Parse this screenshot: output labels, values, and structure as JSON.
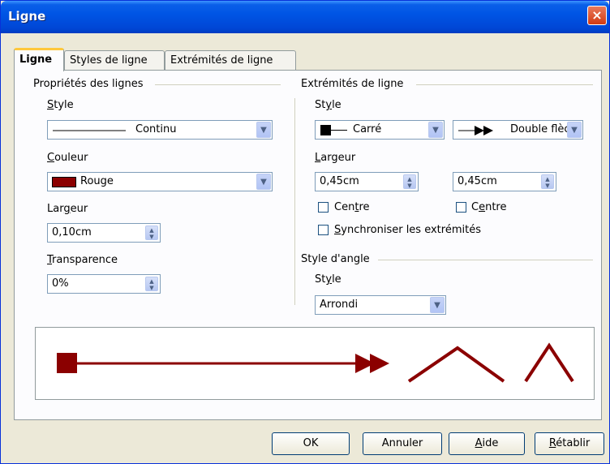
{
  "window": {
    "title": "Ligne",
    "close": "×"
  },
  "tabs": [
    "Ligne",
    "Styles de ligne",
    "Extrémités de ligne"
  ],
  "line_props": {
    "group_title": "Propriétés des lignes",
    "style_label": "Style",
    "style_value": "Continu",
    "color_label": "Couleur",
    "color_value": "Rouge",
    "color_swatch": "#8b0000",
    "width_label": "Largeur",
    "width_value": "0,10cm",
    "transparency_label": "Transparence",
    "transparency_value": "0%"
  },
  "endpoints": {
    "group_title": "Extrémités de ligne",
    "style_label": "Style",
    "start_style": "Carré",
    "end_style": "Double flèc",
    "width_label": "Largeur",
    "start_width": "0,45cm",
    "end_width": "0,45cm",
    "center_label_left": "Centre",
    "center_label_right": "Centre",
    "sync_label": "Synchroniser les extrémités"
  },
  "corner": {
    "group_title": "Style d'angle",
    "style_label": "Style",
    "style_value": "Arrondi"
  },
  "buttons": {
    "ok": "OK",
    "cancel": "Annuler",
    "help": "Aide",
    "reset": "Rétablir"
  },
  "colors": {
    "line": "#8b0000",
    "accent": "#0055e5"
  }
}
